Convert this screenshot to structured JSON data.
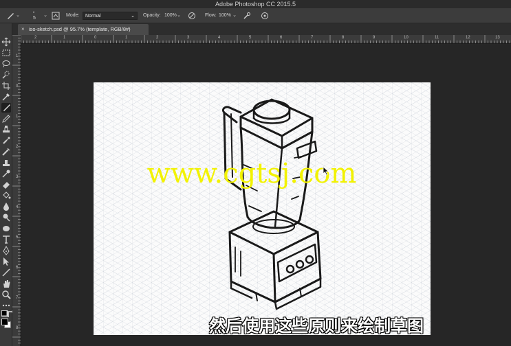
{
  "app": {
    "title": "Adobe Photoshop CC 2015.5"
  },
  "options_bar": {
    "brush_size": "5",
    "mode_label": "Mode:",
    "mode_value": "Normal",
    "opacity_label": "Opacity:",
    "opacity_value": "100%",
    "flow_label": "Flow:",
    "flow_value": "100%"
  },
  "document": {
    "tab_close": "×",
    "tab_title": "iso-sketch.psd @ 95.7% (template, RGB/8#)"
  },
  "rulers": {
    "horizontal": [
      "2",
      "1",
      "0",
      "1",
      "2",
      "3",
      "4",
      "5",
      "6",
      "7",
      "8",
      "9",
      "10",
      "11",
      "12",
      "13"
    ],
    "vertical": [
      "1",
      "0",
      "1",
      "2",
      "3",
      "4",
      "5",
      "6",
      "7",
      "8"
    ]
  },
  "overlay": {
    "watermark": "www.cgtsj.com",
    "subtitle": "然后使用这些原则来绘制草图"
  },
  "colors": {
    "foreground": "#000000",
    "background": "#ffffff",
    "watermark": "#f2f200"
  },
  "tools": [
    "move-tool",
    "marquee-tool",
    "lasso-tool",
    "quick-selection-tool",
    "crop-tool",
    "eyedropper-tool",
    "brush-tool",
    "pencil-tool",
    "clone-stamp-tool",
    "history-brush-tool",
    "healing-brush-tool",
    "stamp-tool",
    "smudge-tool",
    "eraser-tool",
    "paint-bucket-tool",
    "blur-tool",
    "dodge-tool",
    "sponge-tool",
    "type-tool",
    "pen-tool",
    "path-selection-tool",
    "line-tool",
    "hand-tool",
    "zoom-tool",
    "more-tools"
  ]
}
